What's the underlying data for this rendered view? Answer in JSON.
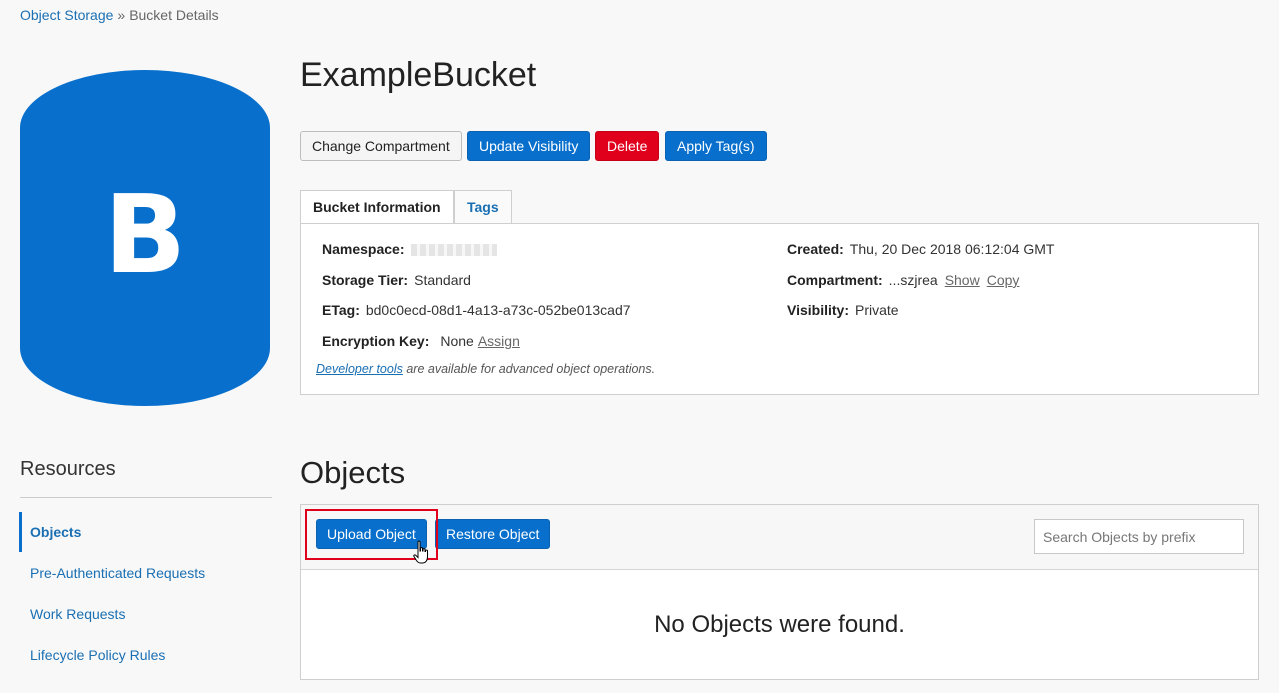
{
  "breadcrumb": {
    "parent": "Object Storage",
    "separator": "»",
    "current": "Bucket Details"
  },
  "bucket": {
    "icon_letter": "B",
    "name": "ExampleBucket"
  },
  "actions": {
    "change_compartment": "Change Compartment",
    "update_visibility": "Update Visibility",
    "delete": "Delete",
    "apply_tags": "Apply Tag(s)"
  },
  "tabs": [
    {
      "label": "Bucket Information",
      "active": true
    },
    {
      "label": "Tags",
      "active": false
    }
  ],
  "info": {
    "namespace_label": "Namespace:",
    "storage_tier_label": "Storage Tier:",
    "storage_tier": "Standard",
    "etag_label": "ETag:",
    "etag": "bd0c0ecd-08d1-4a13-a73c-052be013cad7",
    "encryption_label": "Encryption Key:",
    "encryption": "None",
    "encryption_assign": "Assign",
    "created_label": "Created:",
    "created": "Thu, 20 Dec 2018 06:12:04 GMT",
    "compartment_label": "Compartment:",
    "compartment": "...szjrea",
    "compartment_show": "Show",
    "compartment_copy": "Copy",
    "visibility_label": "Visibility:",
    "visibility": "Private",
    "dev_tools_link": "Developer tools",
    "dev_tools_text": " are available for advanced object operations."
  },
  "resources": {
    "title": "Resources",
    "items": [
      {
        "label": "Objects",
        "active": true
      },
      {
        "label": "Pre-Authenticated Requests"
      },
      {
        "label": "Work Requests"
      },
      {
        "label": "Lifecycle Policy Rules"
      }
    ]
  },
  "objects": {
    "title": "Objects",
    "upload": "Upload Object",
    "restore": "Restore Object",
    "search_placeholder": "Search Objects by prefix",
    "empty_message": "No Objects were found."
  },
  "colors": {
    "primary": "#0870cc",
    "danger": "#e0001b",
    "link": "#1a6fb3",
    "highlight": "#e0001b"
  }
}
